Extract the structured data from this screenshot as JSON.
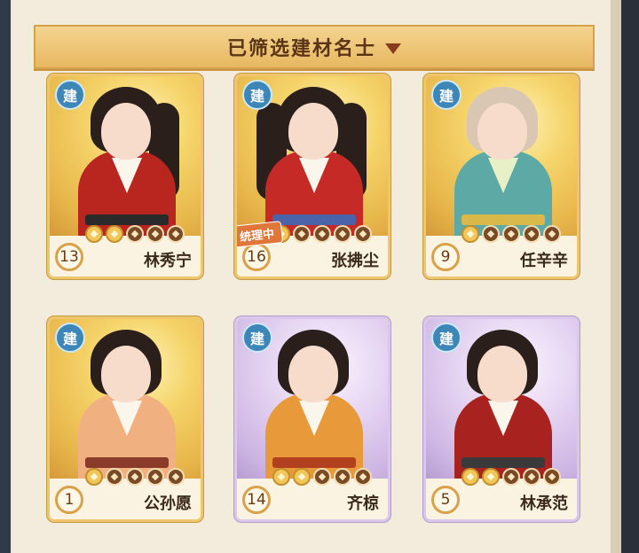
{
  "header": {
    "title": "已筛选建材名士"
  },
  "colors": {
    "accent_gold": "#f0c66c",
    "accent_purple": "#d9c8ea",
    "badge_blue": "#3d86b8",
    "tag_orange": "#e0763a"
  },
  "cards": [
    {
      "badge": "建",
      "level": "13",
      "name": "林秀宁",
      "stars_filled": 2,
      "stars_total": 5,
      "frame": "gold",
      "tag": ""
    },
    {
      "badge": "建",
      "level": "16",
      "name": "张拂尘",
      "stars_filled": 1,
      "stars_total": 5,
      "frame": "gold",
      "tag": "统理中"
    },
    {
      "badge": "建",
      "level": "9",
      "name": "任辛辛",
      "stars_filled": 1,
      "stars_total": 5,
      "frame": "gold",
      "tag": ""
    },
    {
      "badge": "建",
      "level": "1",
      "name": "公孙愿",
      "stars_filled": 1,
      "stars_total": 5,
      "frame": "gold",
      "tag": ""
    },
    {
      "badge": "建",
      "level": "14",
      "name": "齐椋",
      "stars_filled": 2,
      "stars_total": 5,
      "frame": "purple",
      "tag": ""
    },
    {
      "badge": "建",
      "level": "5",
      "name": "林承范",
      "stars_filled": 2,
      "stars_total": 5,
      "frame": "purple",
      "tag": ""
    }
  ]
}
